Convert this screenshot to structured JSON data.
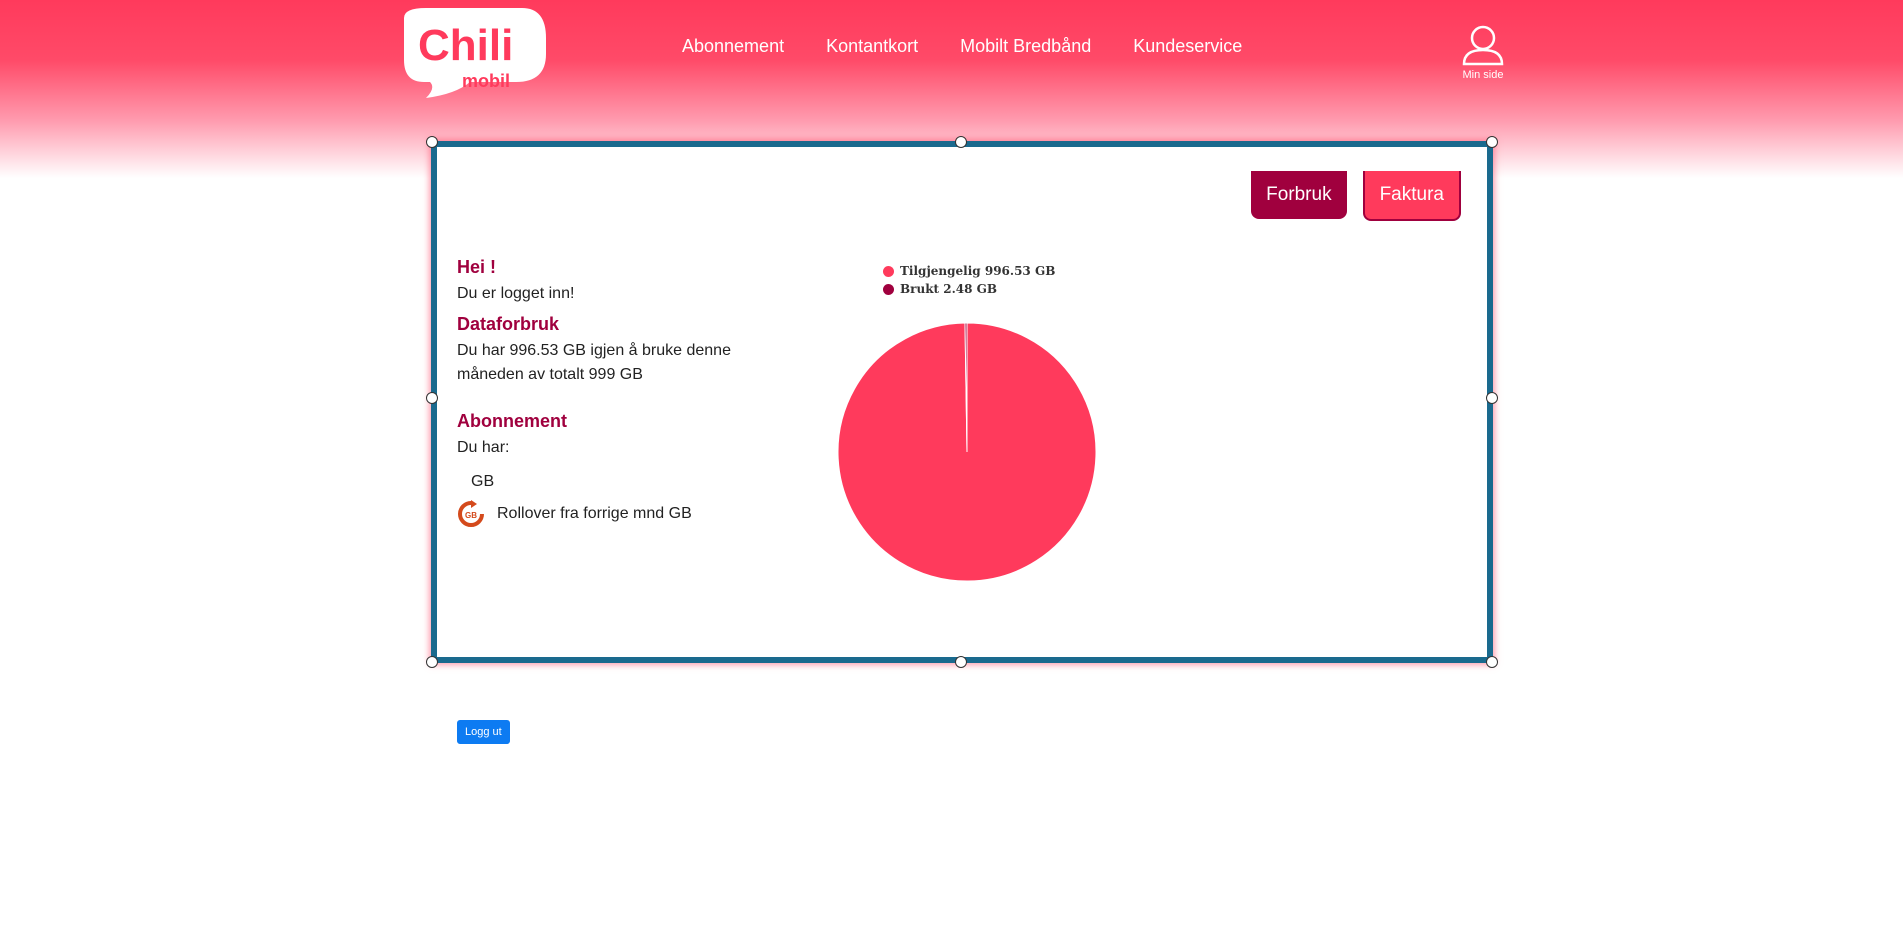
{
  "brand": {
    "logo_text": "Chili",
    "logo_sub": "mobil",
    "colors": {
      "primary": "#ff3a5c",
      "dark": "#a0003e",
      "frame": "#1a6a8e",
      "button": "#0d7bf2"
    }
  },
  "nav": {
    "items": [
      {
        "label": "Abonnement"
      },
      {
        "label": "Kontantkort"
      },
      {
        "label": "Mobilt Bredbånd"
      },
      {
        "label": "Kundeservice"
      }
    ],
    "min_side": {
      "label": "Min side",
      "icon": "user-icon"
    }
  },
  "tabs": [
    {
      "label": "Forbruk",
      "active": true
    },
    {
      "label": "Faktura",
      "active": false
    }
  ],
  "greeting": {
    "title": "Hei !",
    "status": "Du er logget inn!"
  },
  "data_usage": {
    "title": "Dataforbruk",
    "text": "Du har 996.53 GB igjen å bruke denne måneden av totalt 999 GB"
  },
  "subscription": {
    "title": "Abonnement",
    "intro": "Du har:",
    "gb_line": "GB",
    "rollover_text": "Rollover fra forrige mnd GB",
    "rollover_icon": "rollover-gb-icon"
  },
  "chart_data": {
    "type": "pie",
    "legend_position": "top",
    "series": [
      {
        "name": "Tilgjengelig 996.53 GB",
        "value": 996.53,
        "color": "#ff3a5c"
      },
      {
        "name": "Brukt 2.48 GB",
        "value": 2.48,
        "color": "#a0003e"
      }
    ]
  },
  "logout": {
    "label": "Logg ut"
  }
}
